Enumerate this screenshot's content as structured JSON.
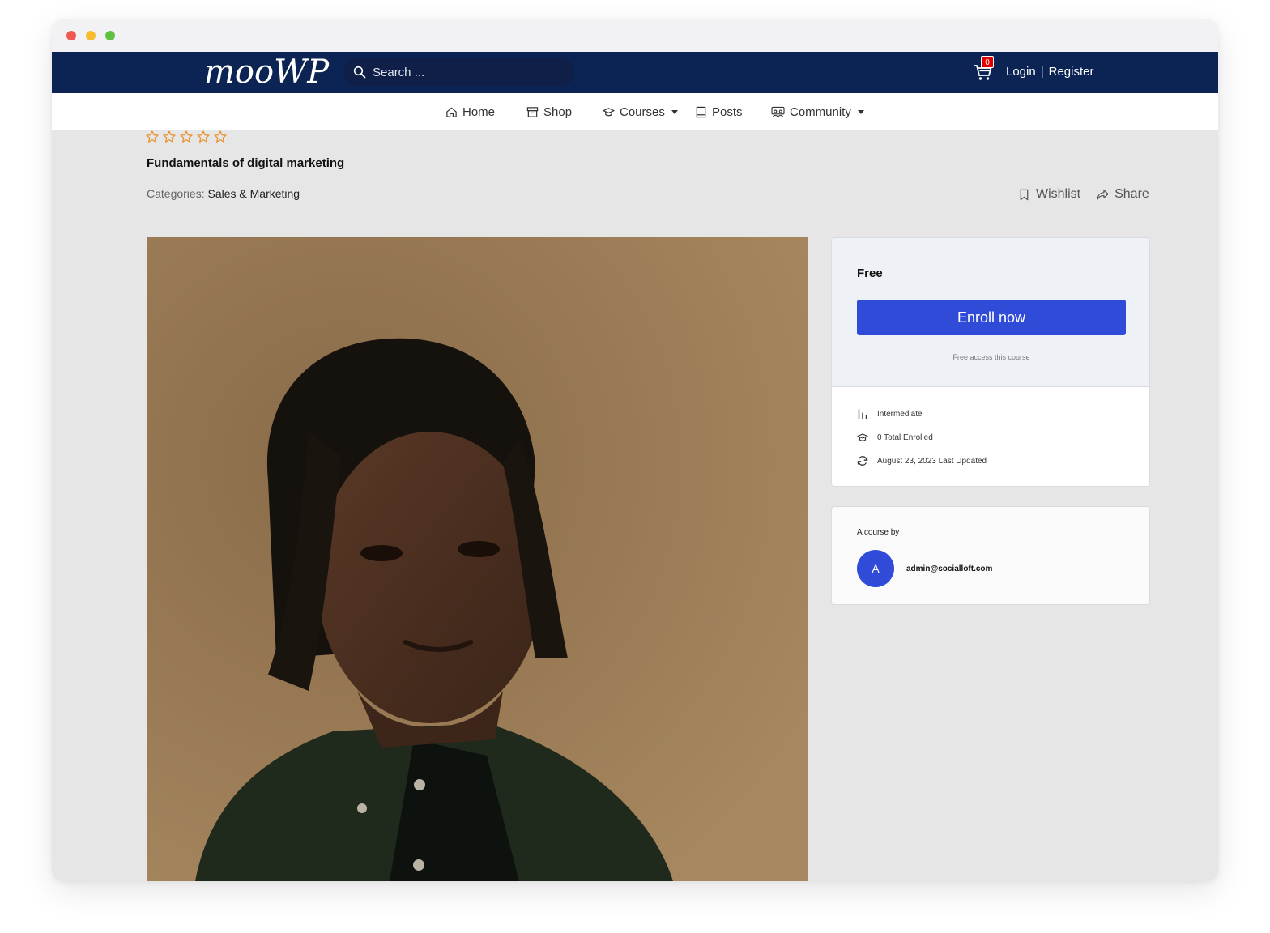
{
  "header": {
    "logo": "mooWP",
    "search_placeholder": "Search ...",
    "cart_count": "0",
    "login": "Login",
    "separator": "|",
    "register": "Register"
  },
  "nav": {
    "items": [
      {
        "label": "Home",
        "icon": "home-icon"
      },
      {
        "label": "Shop",
        "icon": "shop-icon"
      },
      {
        "label": "Courses",
        "icon": "graduation-cap-icon",
        "dropdown": true
      },
      {
        "label": "Posts",
        "icon": "book-icon"
      },
      {
        "label": "Community",
        "icon": "community-icon",
        "dropdown": true
      }
    ]
  },
  "course": {
    "rating_stars": 0,
    "rating_max": 5,
    "title": "Fundamentals of digital marketing",
    "categories_label": "Categories:",
    "category": "Sales & Marketing",
    "wishlist": "Wishlist",
    "share": "Share"
  },
  "enroll_card": {
    "price": "Free",
    "button": "Enroll now",
    "note": "Free access this course",
    "meta": [
      {
        "icon": "level-bars-icon",
        "text": "Intermediate"
      },
      {
        "icon": "graduation-cap-icon",
        "text": "0 Total Enrolled"
      },
      {
        "icon": "refresh-icon",
        "text": "August 23, 2023 Last Updated"
      }
    ]
  },
  "author_card": {
    "label": "A course by",
    "avatar_letter": "A",
    "name": "admin@socialloft.com"
  },
  "colors": {
    "topbar": "#0b2454",
    "accent": "#2f4bd8",
    "star": "#e8912a",
    "badge": "#e00000"
  }
}
